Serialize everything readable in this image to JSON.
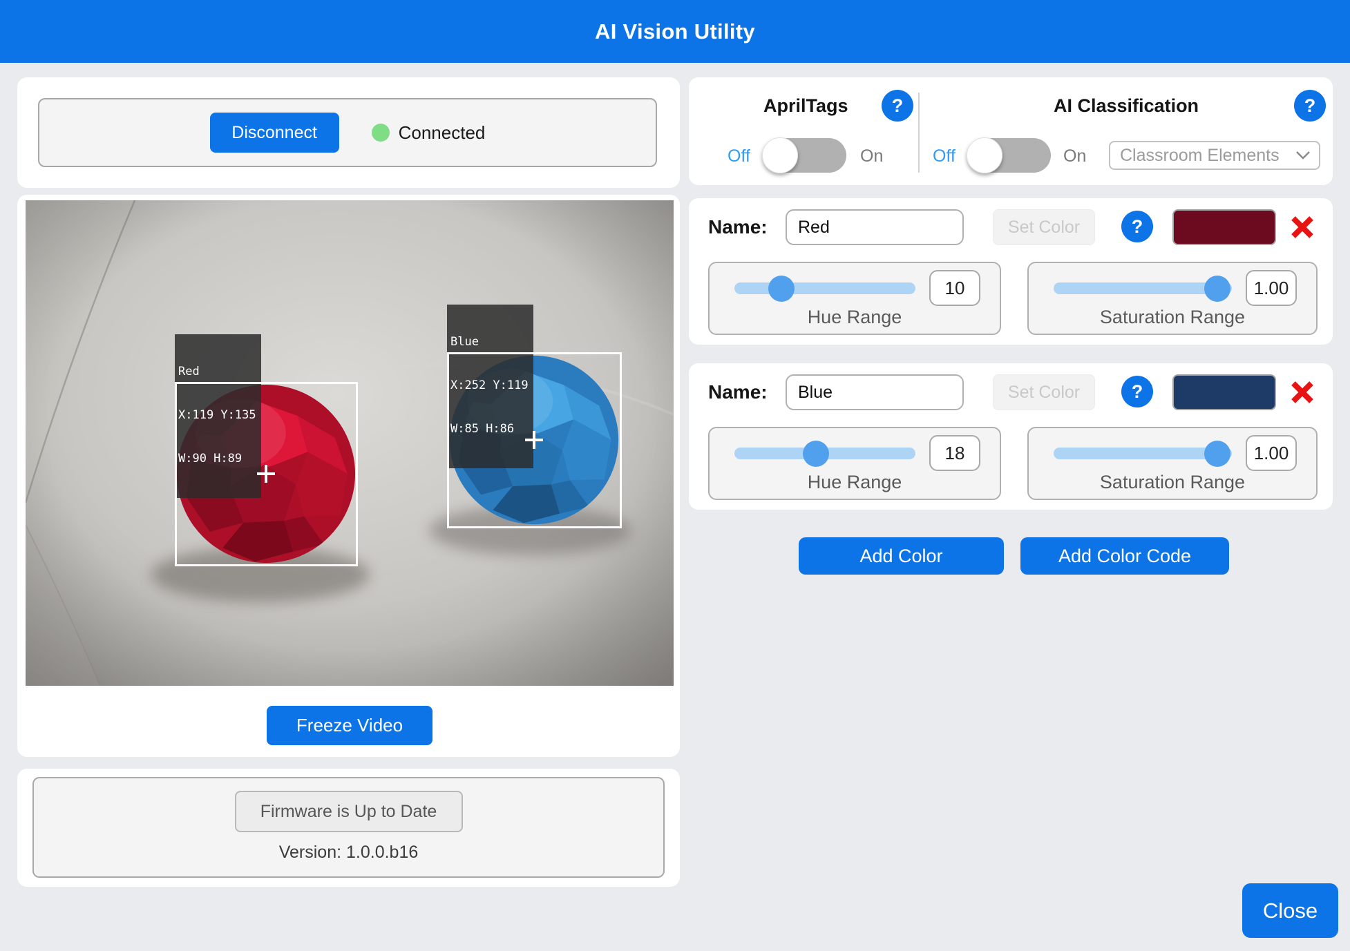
{
  "header": {
    "title": "AI Vision Utility"
  },
  "connection": {
    "disconnect_button": "Disconnect",
    "status_text": "Connected",
    "status_color": "#7edd85"
  },
  "video": {
    "freeze_button": "Freeze Video",
    "detections": [
      {
        "name": "Red",
        "pos": "X:119 Y:135",
        "size": "W:90 H:89"
      },
      {
        "name": "Blue",
        "pos": "X:252 Y:119",
        "size": "W:85 H:86"
      }
    ]
  },
  "firmware": {
    "status_button": "Firmware is Up to Date",
    "version_text": "Version: 1.0.0.b16"
  },
  "apriltags": {
    "title": "AprilTags",
    "help": "?",
    "off_label": "Off",
    "on_label": "On",
    "state": "off"
  },
  "ai_classification": {
    "title": "AI Classification",
    "help": "?",
    "off_label": "Off",
    "on_label": "On",
    "state": "off",
    "model_selected": "Classroom Elements"
  },
  "color_signatures": [
    {
      "name_label": "Name:",
      "name_value": "Red",
      "set_color_button": "Set Color",
      "help": "?",
      "swatch_color": "#6c0a20",
      "hue_range": {
        "value": "10",
        "label": "Hue Range",
        "knob_left": "26%"
      },
      "saturation_range": {
        "value": "1.00",
        "label": "Saturation Range",
        "knob_left": "92%"
      }
    },
    {
      "name_label": "Name:",
      "name_value": "Blue",
      "set_color_button": "Set Color",
      "help": "?",
      "swatch_color": "#1d3b66",
      "hue_range": {
        "value": "18",
        "label": "Hue Range",
        "knob_left": "45%"
      },
      "saturation_range": {
        "value": "1.00",
        "label": "Saturation Range",
        "knob_left": "92%"
      }
    }
  ],
  "footer": {
    "add_color_button": "Add Color",
    "add_color_code_button": "Add Color Code",
    "close_button": "Close"
  },
  "theme": {
    "accent_blue": "#0d74e7",
    "page_background": "#e9ebee",
    "status_green": "#7edd85",
    "delete_red": "#e81414",
    "slider_track": "#aed4f5",
    "slider_knob": "#51a0ed"
  }
}
